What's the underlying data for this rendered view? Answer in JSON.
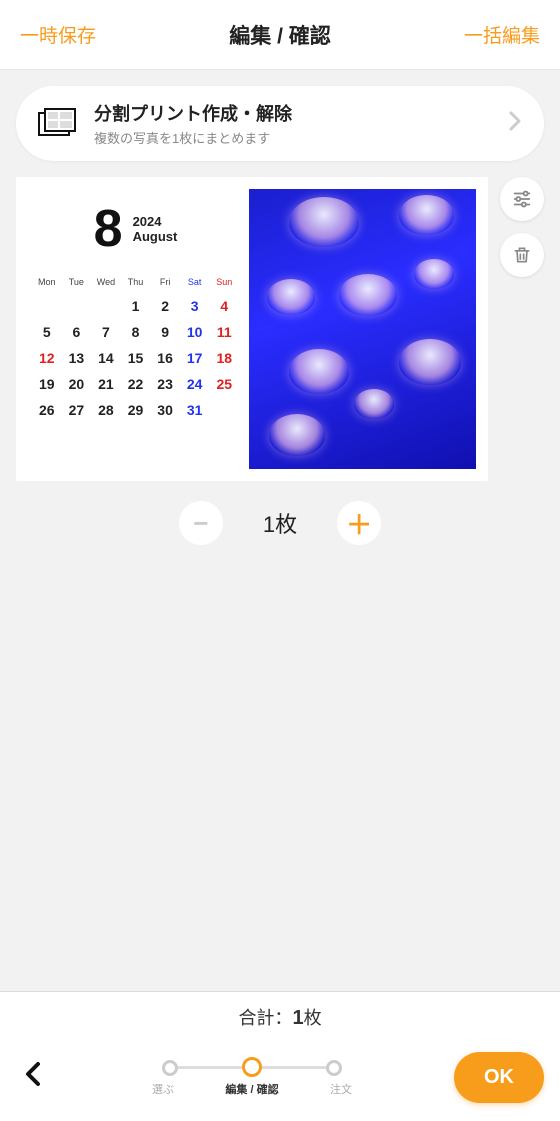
{
  "header": {
    "left": "一時保存",
    "title": "編集 / 確認",
    "right": "一括編集"
  },
  "banner": {
    "title": "分割プリント作成・解除",
    "subtitle": "複数の写真を1枚にまとめます"
  },
  "calendar": {
    "monthNum": "8",
    "year": "2024",
    "monthName": "August",
    "dow": [
      "Mon",
      "Tue",
      "Wed",
      "Thu",
      "Fri",
      "Sat",
      "Sun"
    ],
    "leadingBlanks": 3,
    "days": 31,
    "satCol": 5,
    "sunCol": 6,
    "holidays": [
      12
    ]
  },
  "stepper": {
    "count": "1枚"
  },
  "total": {
    "label": "合計：",
    "value": "1",
    "unit": "枚"
  },
  "footer": {
    "steps": [
      "選ぶ",
      "編集 / 確認",
      "注文"
    ],
    "activeStep": 1,
    "ok": "OK"
  }
}
